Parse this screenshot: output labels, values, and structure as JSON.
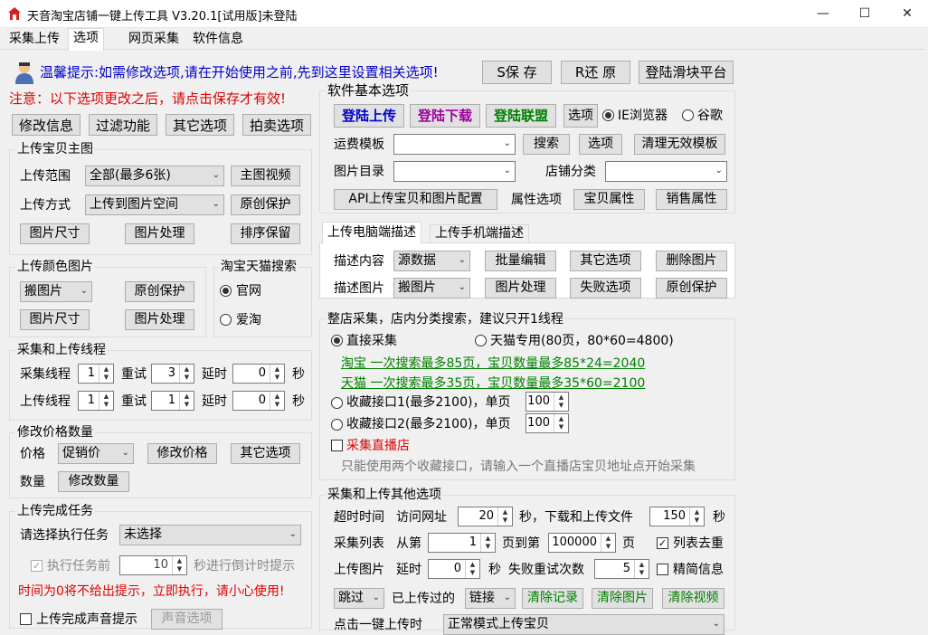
{
  "window": {
    "title": "天音淘宝店铺一键上传工具 V3.20.1[试用版]未登陆",
    "minimize": "—",
    "maximize": "☐",
    "close": "✕"
  },
  "tabs": [
    "采集上传",
    "选项",
    "网页采集",
    "软件信息"
  ],
  "header": {
    "tip": "温馨提示:如需修改选项,请在开始使用之前,先到这里设置相关选项!",
    "save": "S保 存",
    "restore": "R还 原",
    "login_slider": "登陆滑块平台",
    "notice": "注意：以下选项更改之后，请点击保存才有效!"
  },
  "left_buttons": [
    "修改信息",
    "过滤功能",
    "其它选项",
    "拍卖选项"
  ],
  "main_image": {
    "title": "上传宝贝主图",
    "range_label": "上传范围",
    "range_value": "全部(最多6张)",
    "video_btn": "主图视频",
    "method_label": "上传方式",
    "method_value": "上传到图片空间",
    "orig_protect": "原创保护",
    "img_size": "图片尺寸",
    "img_process": "图片处理",
    "sort_keep": "排序保留"
  },
  "color_image": {
    "title": "上传颜色图片",
    "value": "搬图片",
    "orig_protect": "原创保护",
    "img_size": "图片尺寸",
    "img_process": "图片处理"
  },
  "tmall_search": {
    "title": "淘宝天猫搜索",
    "opt1": "官网",
    "opt2": "爱淘"
  },
  "threads": {
    "title": "采集和上传线程",
    "collect_label": "采集线程",
    "collect_val": "1",
    "retry_label": "重试",
    "retry1": "3",
    "delay_label": "延时",
    "delay1": "0",
    "sec": "秒",
    "upload_label": "上传线程",
    "upload_val": "1",
    "retry2": "1",
    "delay2": "0"
  },
  "price": {
    "title": "修改价格数量",
    "price_label": "价格",
    "price_value": "促销价",
    "modify_price": "修改价格",
    "other": "其它选项",
    "qty_label": "数量",
    "modify_qty": "修改数量"
  },
  "finish": {
    "title": "上传完成任务",
    "select_label": "请选择执行任务",
    "select_value": "未选择",
    "exec_label": "执行任务前",
    "exec_val": "10",
    "exec_suffix": "秒进行倒计时提示",
    "warn": "时间为0将不给出提示，立即执行，请小心使用!",
    "sound_label": "上传完成声音提示",
    "sound_btn": "声音选项"
  },
  "software": {
    "title": "软件基本选项",
    "login_upload": "登陆上传",
    "login_download": "登陆下载",
    "login_alliance": "登陆联盟",
    "options": "选项",
    "ie": "IE浏览器",
    "chrome": "谷歌",
    "freight_label": "运费模板",
    "search": "搜索",
    "options2": "选项",
    "clear_invalid": "清理无效模板",
    "img_dir_label": "图片目录",
    "shop_cat_label": "店铺分类",
    "api_config": "API上传宝贝和图片配置",
    "attr_label": "属性选项",
    "item_attr": "宝贝属性",
    "sale_attr": "销售属性"
  },
  "desc": {
    "tab_pc": "上传电脑端描述",
    "tab_mobile": "上传手机端描述",
    "content_label": "描述内容",
    "content_value": "源数据",
    "batch_edit": "批量编辑",
    "other": "其它选项",
    "delete_img": "删除图片",
    "img_label": "描述图片",
    "img_value": "搬图片",
    "img_process": "图片处理",
    "fail_options": "失败选项",
    "orig_protect": "原创保护"
  },
  "shop_collect": {
    "title": "整店采集，店内分类搜索，建议只开1线程",
    "direct": "直接采集",
    "tmall_only": "天猫专用(80页，80*60=4800)",
    "link1": "淘宝 一次搜索最多85页，宝贝数量最多85*24=2040",
    "link2": "天猫 一次搜索最多35页，宝贝数量最多35*60=2100",
    "fav1": "收藏接口1(最多2100)，单页",
    "fav1_val": "100",
    "fav2": "收藏接口2(最多2100)，单页",
    "fav2_val": "100",
    "live": "采集直播店",
    "live_hint": "只能使用两个收藏接口，请输入一个直播店宝贝地址点开始采集"
  },
  "other_opts": {
    "title": "采集和上传其他选项",
    "timeout_label": "超时时间",
    "visit_label": "访问网址",
    "visit_val": "20",
    "sec_dl": "秒，下载和上传文件",
    "dl_val": "150",
    "sec": "秒",
    "list_label": "采集列表",
    "from": "从第",
    "from_val": "1",
    "to": "页到第",
    "to_val": "100000",
    "page": "页",
    "dedup": "列表去重",
    "upimg_label": "上传图片",
    "delay": "延时",
    "delay_val": "0",
    "sec2": "秒",
    "fail_retry": "失败重试次数",
    "retry_val": "5",
    "simplify": "精简信息",
    "skip_value": "跳过",
    "uploaded_label": "已上传过的",
    "link_value": "链接",
    "clear_records": "清除记录",
    "clear_images": "清除图片",
    "clear_videos": "清除视频",
    "partial_label": "点击一键上传时",
    "partial_value": "正常模式上传宝贝"
  }
}
